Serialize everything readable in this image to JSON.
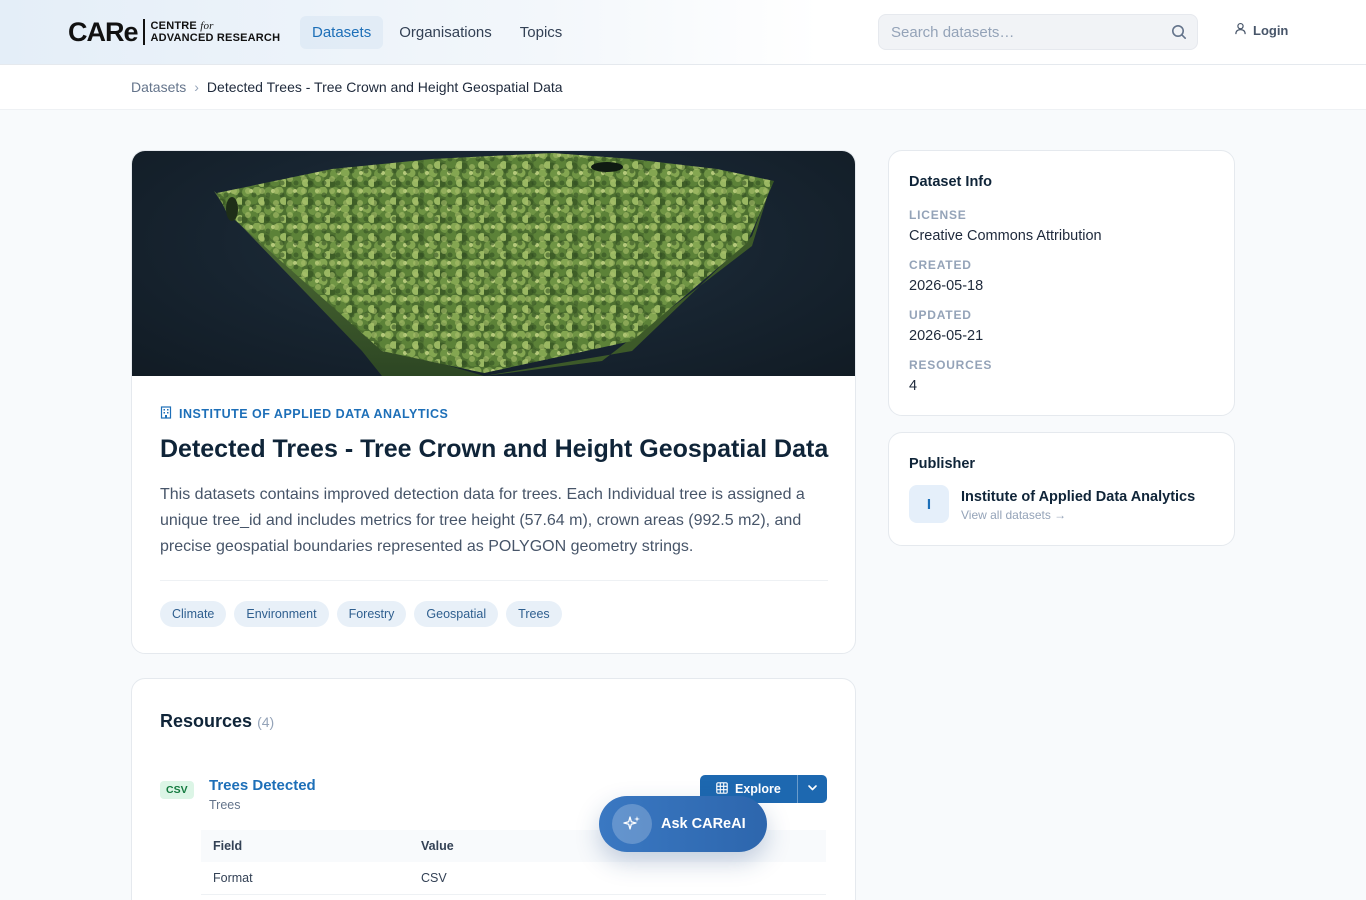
{
  "header": {
    "logo_main": "CARe",
    "logo_line1": "CENTRE",
    "logo_line1_suffix": "for",
    "logo_line2": "ADVANCED RESEARCH",
    "nav": [
      {
        "label": "Datasets",
        "active": true
      },
      {
        "label": "Organisations",
        "active": false
      },
      {
        "label": "Topics",
        "active": false
      }
    ],
    "search_placeholder": "Search datasets…",
    "login_label": "Login"
  },
  "breadcrumb": {
    "root": "Datasets",
    "separator": "›",
    "current": "Detected Trees - Tree Crown and Height Geospatial Data"
  },
  "dataset": {
    "organisation": "INSTITUTE OF APPLIED DATA ANALYTICS",
    "title": "Detected Trees - Tree Crown and Height Geospatial Data",
    "description": "This datasets contains improved detection data for trees. Each Individual tree is assigned a unique tree_id and includes metrics for tree height (57.64 m), crown areas (992.5 m2), and precise geospatial boundaries represented as POLYGON geometry strings.",
    "tags": [
      "Climate",
      "Environment",
      "Forestry",
      "Geospatial",
      "Trees"
    ]
  },
  "resources": {
    "title": "Resources",
    "count": "(4)",
    "items": [
      {
        "format": "CSV",
        "name": "Trees Detected",
        "subtitle": "Trees",
        "explore_label": "Explore",
        "table_headers": [
          "Field",
          "Value"
        ],
        "table_rows": [
          [
            "Format",
            "CSV"
          ]
        ]
      }
    ]
  },
  "info": {
    "title": "Dataset Info",
    "license_label": "LICENSE",
    "license": "Creative Commons Attribution",
    "created_label": "CREATED",
    "created": "2026-05-18",
    "updated_label": "UPDATED",
    "updated": "2026-05-21",
    "resources_label": "RESOURCES",
    "resources": "4"
  },
  "publisher": {
    "title": "Publisher",
    "initial": "I",
    "name": "Institute of Applied Data Analytics",
    "link": "View all datasets →"
  },
  "ai_button": {
    "label": "Ask CAReAI"
  },
  "colors": {
    "accent": "#1d6fb8",
    "title": "#0f2438",
    "tag_bg": "#e8f0f8",
    "csv_badge_bg": "#dcf5e6",
    "csv_badge_text": "#137a3f"
  },
  "icons": [
    "search-icon",
    "user-icon",
    "building-icon",
    "grid-icon",
    "chevron-down-icon",
    "sparkle-icon"
  ]
}
